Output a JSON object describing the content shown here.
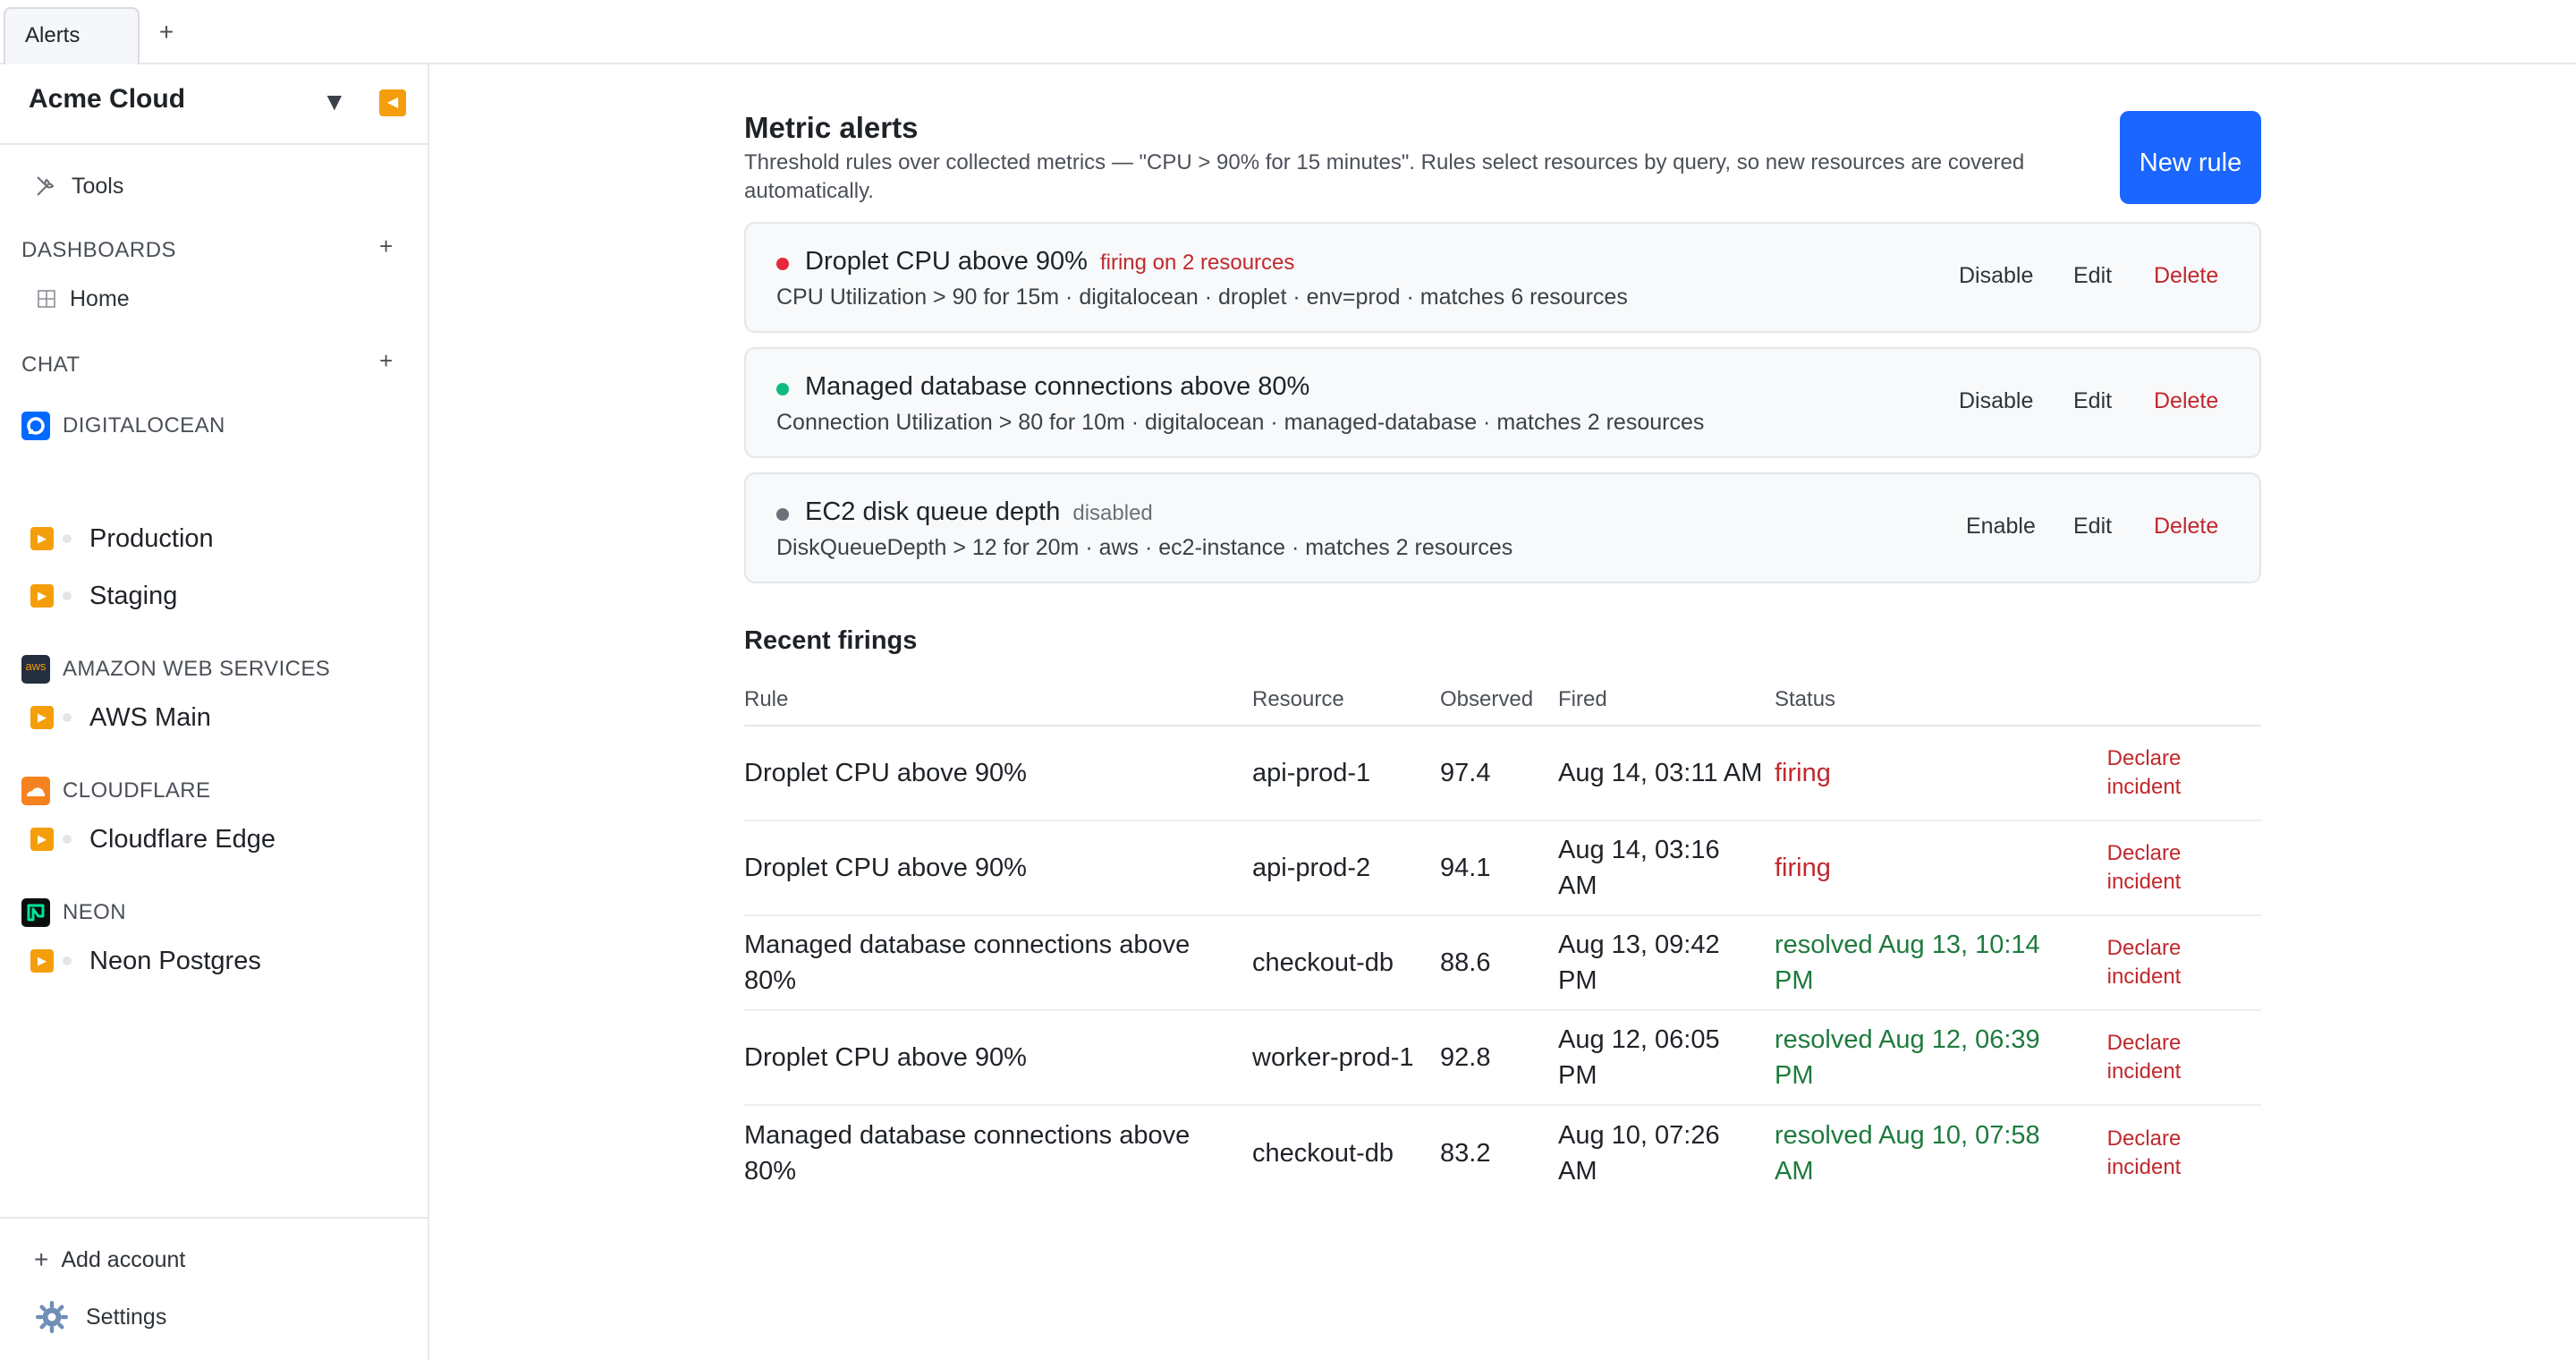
{
  "tabs": [
    {
      "label": "Alerts"
    }
  ],
  "tab_add": "+",
  "sidebar": {
    "workspace": "Acme Cloud",
    "caret": "▼",
    "collapse": "◀",
    "tools": "Tools",
    "dashboards_label": "DASHBOARDS",
    "dashboards": [
      {
        "label": "Home"
      }
    ],
    "chat_label": "CHAT",
    "plus": "+",
    "providers": [
      {
        "name": "DIGITALOCEAN",
        "icon": "digitalocean-logo-icon",
        "color": "#0069ff",
        "connections": [
          {
            "label": "Production"
          },
          {
            "label": "Staging"
          }
        ]
      },
      {
        "name": "AMAZON WEB SERVICES",
        "icon": "aws-logo-icon",
        "color": "#232f3e",
        "connections": [
          {
            "label": "AWS Main"
          }
        ]
      },
      {
        "name": "CLOUDFLARE",
        "icon": "cloudflare-logo-icon",
        "color": "#f6821f",
        "connections": [
          {
            "label": "Cloudflare Edge"
          }
        ]
      },
      {
        "name": "NEON",
        "icon": "neon-logo-icon",
        "color": "#0b0d0e",
        "connections": [
          {
            "label": "Neon Postgres"
          }
        ]
      }
    ],
    "aws_logo_text": "aws",
    "add_account": "Add account",
    "settings": "Settings"
  },
  "main": {
    "title": "Metric alerts",
    "description": "Threshold rules over collected metrics — \"CPU > 90% for 15 minutes\". Rules select resources by query, so new resources are covered automatically.",
    "new_rule": "New rule",
    "rules": [
      {
        "title": "Droplet CPU above 90%",
        "tag": "firing on 2 resources",
        "tag_color": "#c0282d",
        "dot_color": "#e5293b",
        "subtitle": "CPU Utilization > 90 for 15m · digitalocean · droplet · env=prod · matches 6 resources",
        "toggle": "Disable",
        "edit": "Edit",
        "delete": "Delete"
      },
      {
        "title": "Managed database connections above 80%",
        "tag": "",
        "tag_color": "#4b5058",
        "dot_color": "#10b981",
        "subtitle": "Connection Utilization > 80 for 10m · digitalocean · managed-database · matches 2 resources",
        "toggle": "Disable",
        "edit": "Edit",
        "delete": "Delete"
      },
      {
        "title": "EC2 disk queue depth",
        "tag": "disabled",
        "tag_color": "#6b7079",
        "dot_color": "#6b7079",
        "subtitle": "DiskQueueDepth > 12 for 20m · aws · ec2-instance · matches 2 resources",
        "toggle": "Enable",
        "edit": "Edit",
        "delete": "Delete"
      }
    ],
    "firings_title": "Recent firings",
    "columns": [
      "Rule",
      "Resource",
      "Observed",
      "Fired",
      "Status"
    ],
    "firings": [
      {
        "rule": "Droplet CPU above 90%",
        "resource": "api-prod-1",
        "observed": "97.4",
        "fired": "Aug 14, 03:11 AM",
        "status": "firing",
        "status_kind": "firing",
        "action": "Declare incident"
      },
      {
        "rule": "Droplet CPU above 90%",
        "resource": "api-prod-2",
        "observed": "94.1",
        "fired": "Aug 14, 03:16 AM",
        "status": "firing",
        "status_kind": "firing",
        "action": "Declare incident"
      },
      {
        "rule": "Managed database connections above 80%",
        "resource": "checkout-db",
        "observed": "88.6",
        "fired": "Aug 13, 09:42 PM",
        "status": "resolved Aug 13, 10:14 PM",
        "status_kind": "resolved",
        "action": "Declare incident"
      },
      {
        "rule": "Droplet CPU above 90%",
        "resource": "worker-prod-1",
        "observed": "92.8",
        "fired": "Aug 12, 06:05 PM",
        "status": "resolved Aug 12, 06:39 PM",
        "status_kind": "resolved",
        "action": "Declare incident"
      },
      {
        "rule": "Managed database connections above 80%",
        "resource": "checkout-db",
        "observed": "83.2",
        "fired": "Aug 10, 07:26 AM",
        "status": "resolved Aug 10, 07:58 AM",
        "status_kind": "resolved",
        "action": "Declare incident"
      }
    ]
  }
}
